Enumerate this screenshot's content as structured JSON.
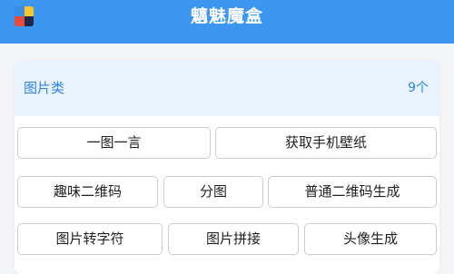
{
  "header": {
    "title": "魑魅魔盒",
    "logo": "app-logo-four-color-squares",
    "background_color": "#3d97f0"
  },
  "section": {
    "title": "图片类",
    "count": "9个",
    "accent_color": "#2e84e0"
  },
  "tools": [
    {
      "label": "一图一言"
    },
    {
      "label": "获取手机壁纸"
    },
    {
      "label": "趣味二维码"
    },
    {
      "label": "分图"
    },
    {
      "label": "普通二维码生成"
    },
    {
      "label": "图片转字符"
    },
    {
      "label": "图片拼接"
    },
    {
      "label": "头像生成"
    }
  ]
}
